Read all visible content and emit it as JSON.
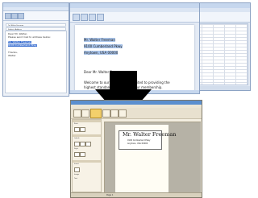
{
  "email_window": {
    "to_value": "To: Walter Freeman",
    "subject_value": "Subject: Address",
    "body_lines": [
      "Dear Mr. Walter,",
      "Please send mail to address below:"
    ],
    "selected_lines": [
      "Mr. Walter Freeman",
      "9100 Cumberland Pkwy"
    ],
    "closing_lines": [
      "Thanks,",
      "Walter"
    ]
  },
  "word_window": {
    "address_lines": [
      "Mr. Walter Freeman",
      "9100 Cumberland Pkwy",
      "Anytown, USA 00000"
    ],
    "salutation": "Dear Mr. Walter Freeman",
    "paragraph_lines": [
      "Welcome to our club. We are excited to providing the",
      "highest standards of service to our membership."
    ]
  },
  "label_window": {
    "label_text": {
      "name": "Mr. Walter Freeman",
      "address_line_1": "9100 Cumberland Pkwy",
      "address_line_2": "Anytown, USA 00000"
    },
    "sidebar_labels": [
      "Print",
      "Labels",
      "Style",
      "Insert",
      "Image",
      "Text"
    ],
    "status_page": "Page 1"
  },
  "colors": {
    "arrow": "#000000",
    "office_blue": "#c6d7ee",
    "label_app_bg": "#efe9da",
    "selection_blue": "#3a6fd0"
  }
}
